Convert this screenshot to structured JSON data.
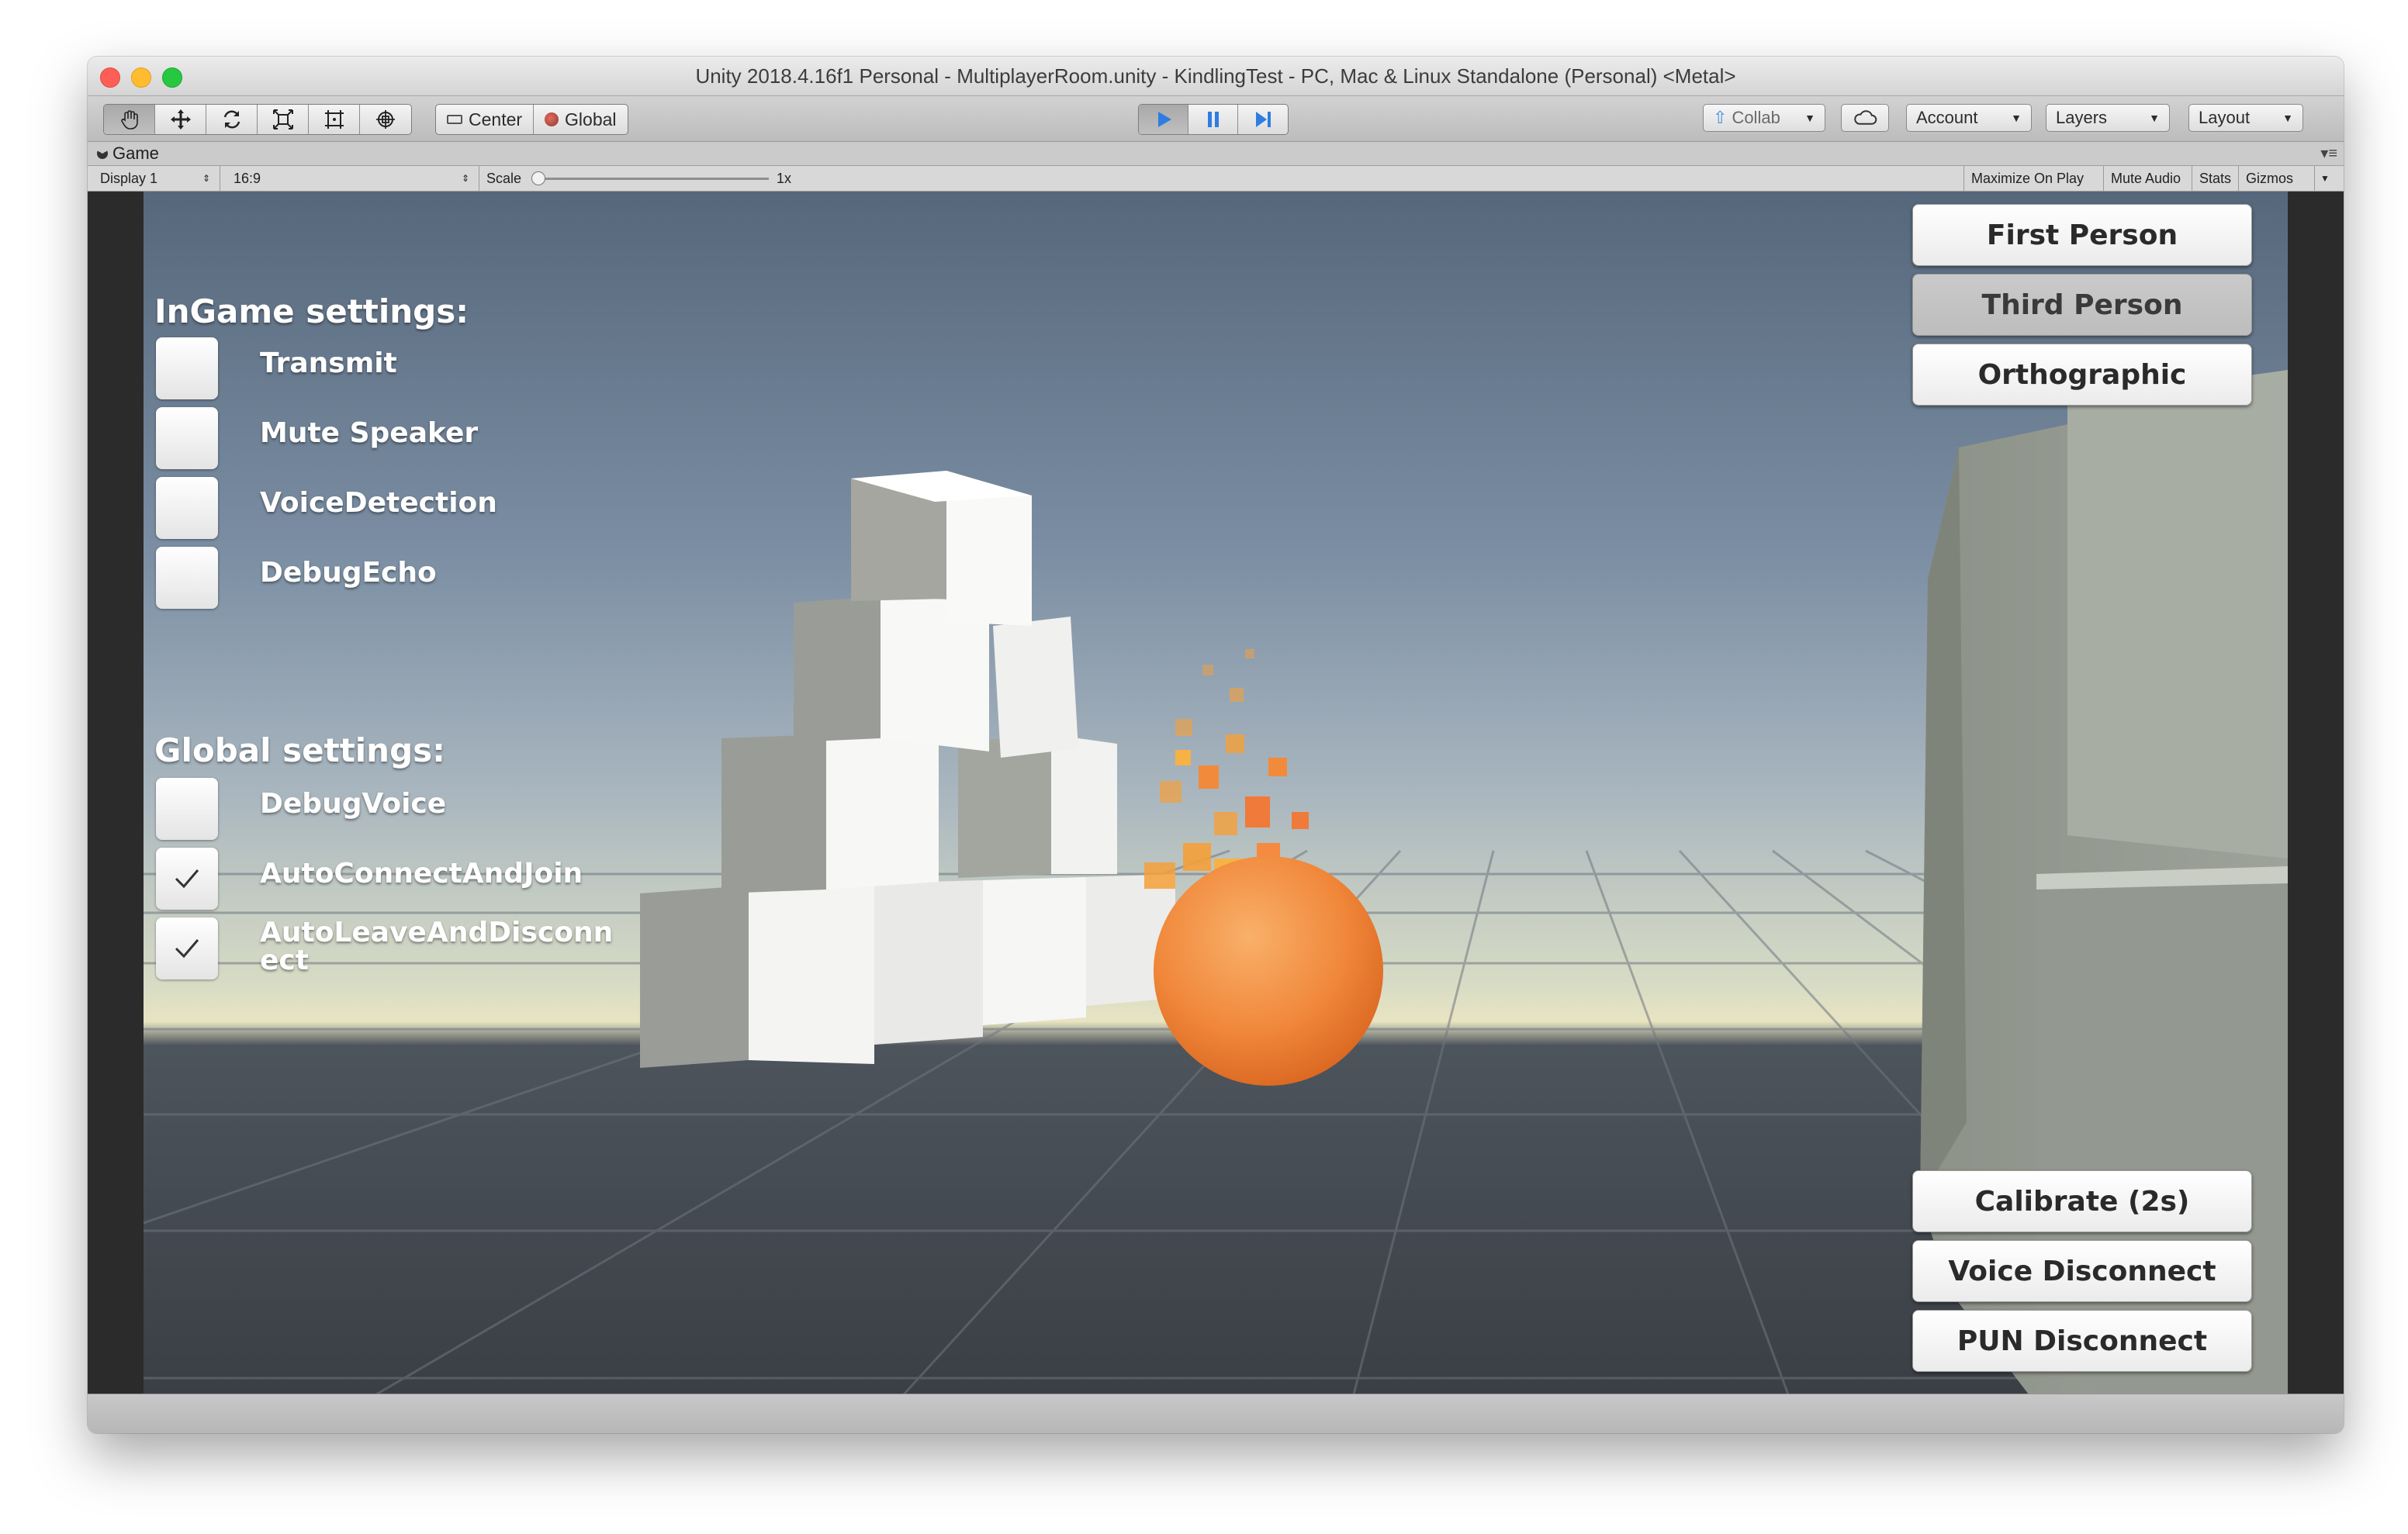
{
  "window": {
    "title": "Unity 2018.4.16f1 Personal - MultiplayerRoom.unity - KindlingTest - PC, Mac & Linux Standalone (Personal) <Metal>"
  },
  "toolbar": {
    "tools": [
      "hand-icon",
      "move-icon",
      "rotate-icon",
      "scale-icon",
      "rect-icon",
      "transform-icon"
    ],
    "pivot_label": "Center",
    "space_label": "Global",
    "collab_label": "Collab",
    "account_label": "Account",
    "layers_label": "Layers",
    "layout_label": "Layout"
  },
  "game_tab": {
    "label": "Game"
  },
  "game_bar": {
    "display": "Display 1",
    "aspect": "16:9",
    "scale_label": "Scale",
    "scale_value": "1x",
    "maximize_on_play": "Maximize On Play",
    "mute_audio": "Mute Audio",
    "stats": "Stats",
    "gizmos": "Gizmos"
  },
  "ingame": {
    "heading": "InGame settings:",
    "toggles": [
      {
        "label": "Transmit",
        "checked": false
      },
      {
        "label": "Mute Speaker",
        "checked": false
      },
      {
        "label": "VoiceDetection",
        "checked": false
      },
      {
        "label": "DebugEcho",
        "checked": false
      }
    ]
  },
  "global": {
    "heading": "Global settings:",
    "toggles": [
      {
        "label": "DebugVoice",
        "checked": false
      },
      {
        "label": "AutoConnectAndJoin",
        "checked": true
      },
      {
        "label": "AutoLeaveAndDisconnect",
        "checked": true
      }
    ]
  },
  "camera_buttons": [
    {
      "label": "First Person",
      "selected": false
    },
    {
      "label": "Third Person",
      "selected": true
    },
    {
      "label": "Orthographic",
      "selected": false
    }
  ],
  "action_buttons": [
    {
      "label": "Calibrate (2s)"
    },
    {
      "label": "Voice Disconnect"
    },
    {
      "label": "PUN Disconnect"
    }
  ],
  "colors": {
    "play_accent": "#2f7de1",
    "sphere": "#f0873a",
    "fire": "#f5a03a"
  }
}
